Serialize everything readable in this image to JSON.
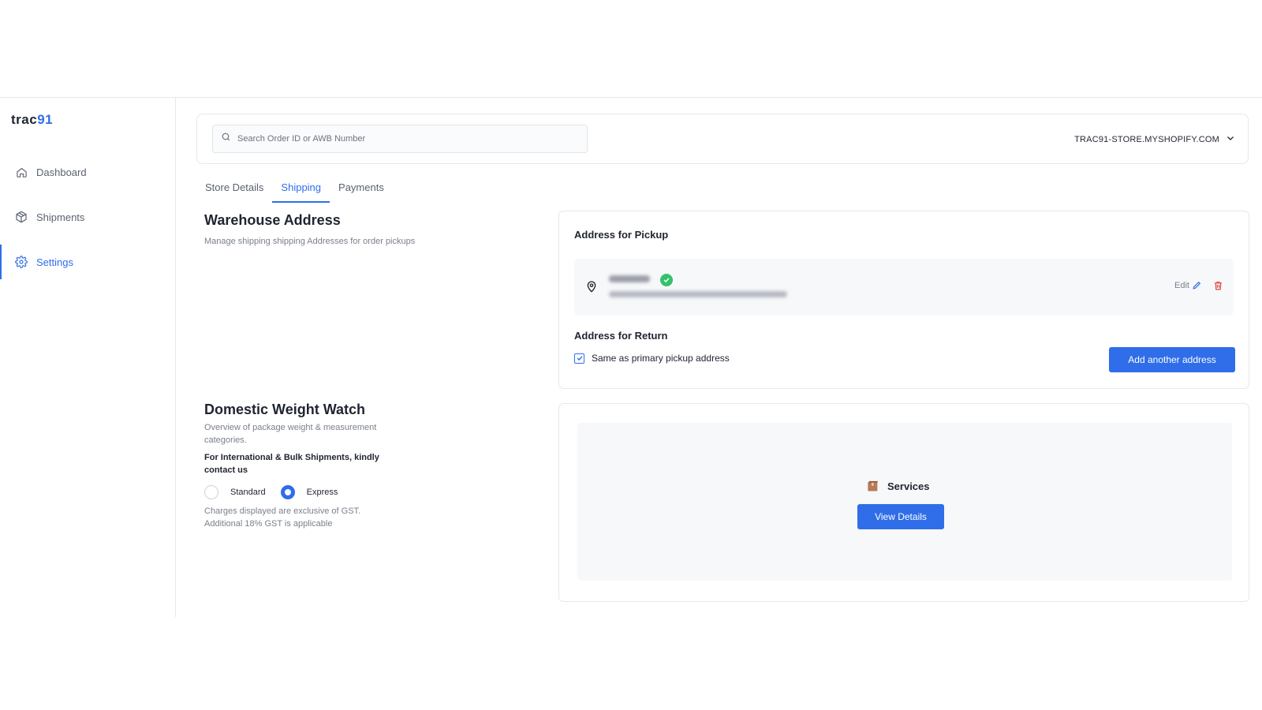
{
  "brand": {
    "logo_left": "trac",
    "logo_right": "91"
  },
  "sidebar": {
    "items": [
      {
        "label": "Dashboard",
        "icon": "home-icon",
        "active": false
      },
      {
        "label": "Shipments",
        "icon": "box-icon",
        "active": false
      },
      {
        "label": "Settings",
        "icon": "gear-icon",
        "active": true
      }
    ]
  },
  "topbar": {
    "search_placeholder": "Search Order ID or AWB Number",
    "store_name": "TRAC91-STORE.MYSHOPIFY.COM"
  },
  "tabs": [
    {
      "label": "Store Details",
      "active": false
    },
    {
      "label": "Shipping",
      "active": true
    },
    {
      "label": "Payments",
      "active": false
    }
  ],
  "warehouse": {
    "title": "Warehouse Address",
    "description": "Manage shipping shipping Addresses for order pickups"
  },
  "pickup_card": {
    "pickup_title": "Address for Pickup",
    "edit_label": "Edit",
    "return_title": "Address for Return",
    "same_as_primary_label": "Same as primary pickup address",
    "same_as_primary_checked": true,
    "add_address_label": "Add another address"
  },
  "weight_watch": {
    "title": "Domestic Weight Watch",
    "description": "Overview of package weight & measurement categories.",
    "note": "For International & Bulk Shipments, kindly contact us",
    "options": [
      {
        "label": "Standard",
        "selected": false
      },
      {
        "label": "Express",
        "selected": true
      }
    ],
    "gst_note": "Charges displayed are exclusive of GST. Additional 18% GST is applicable"
  },
  "services_card": {
    "label": "Services",
    "button_label": "View Details"
  },
  "colors": {
    "accent": "#2f6ee8",
    "success": "#33c26b",
    "danger": "#e0473c"
  }
}
